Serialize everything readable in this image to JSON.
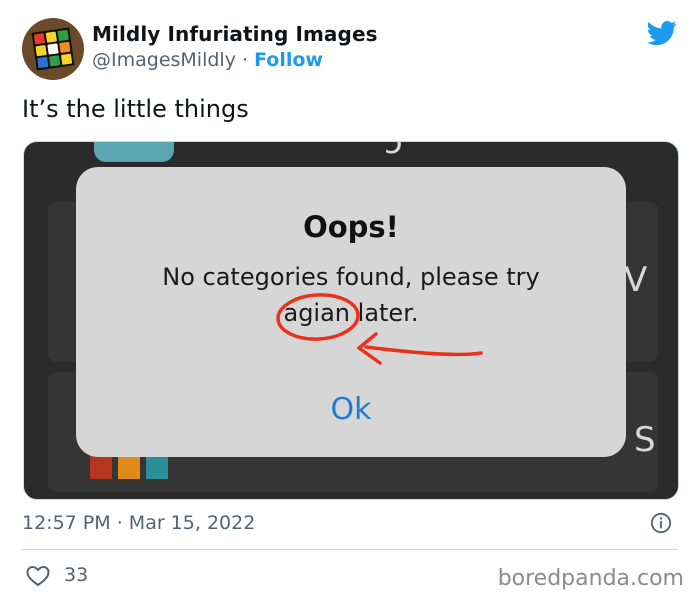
{
  "author": {
    "name": "Mildly Infuriating Images",
    "handle": "@ImagesMildly",
    "separator": "·",
    "follow_label": "Follow",
    "avatar_icon": "rubiks-cube-icon"
  },
  "tweet": {
    "text": "It’s the little things",
    "time": "12:57 PM",
    "separator": "·",
    "date": "Mar 15, 2022",
    "likes": "33"
  },
  "media": {
    "dialog_title": "Oops!",
    "message_line1": "No categories found, please try",
    "message_word_circled": "agian",
    "message_line2_rest": " later.",
    "ok_label": "Ok",
    "bg_glyph_top": "ɔ",
    "bg_glyph_mid": "V",
    "bg_glyph_bottom": "S",
    "annotation_color": "#e8321c"
  },
  "watermark": "boredpanda.com",
  "colors": {
    "accent": "#1d9bf0",
    "secondary_text": "#536471",
    "ok_blue": "#1e7bd7"
  }
}
